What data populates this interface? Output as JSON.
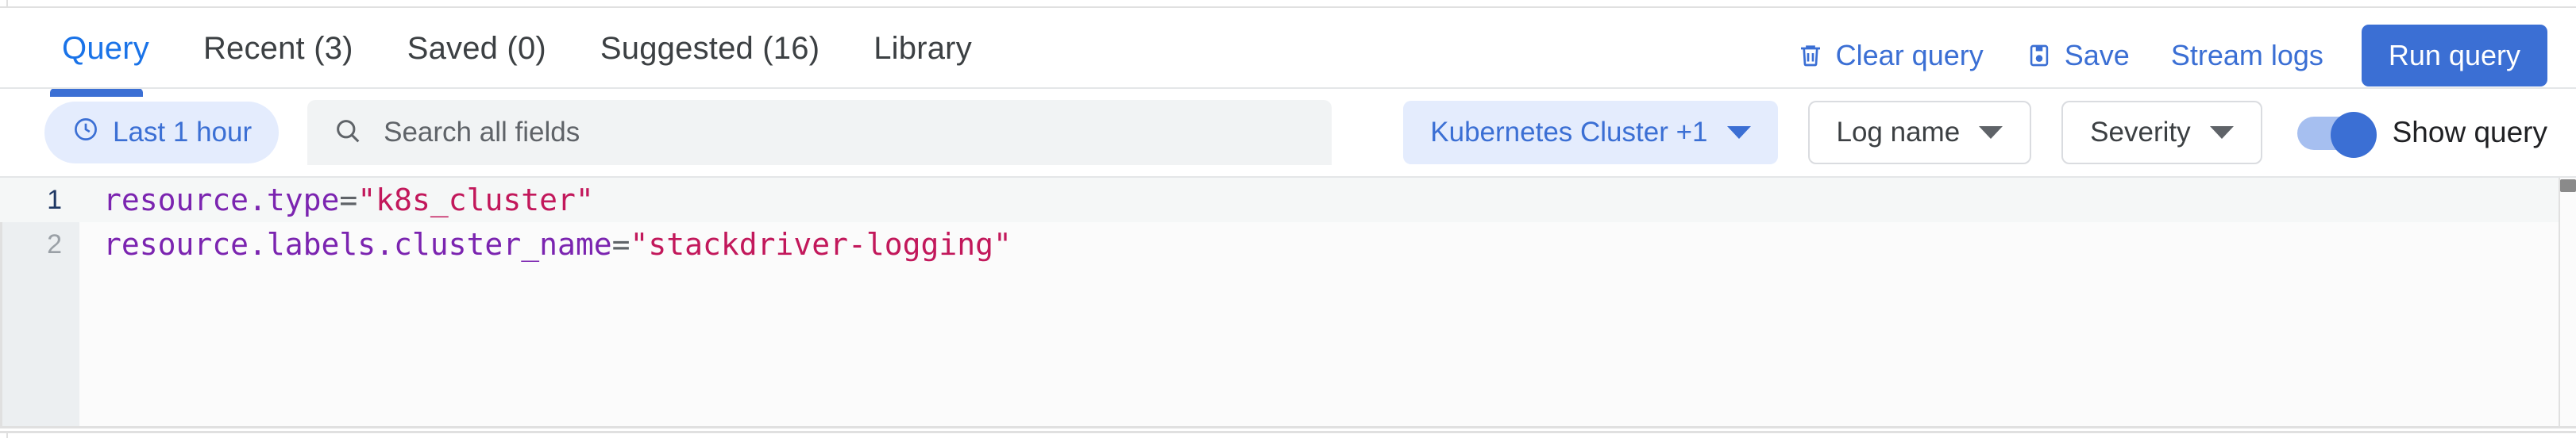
{
  "tabs": [
    {
      "label": "Query",
      "active": true
    },
    {
      "label": "Recent (3)",
      "active": false
    },
    {
      "label": "Saved (0)",
      "active": false
    },
    {
      "label": "Suggested (16)",
      "active": false
    },
    {
      "label": "Library",
      "active": false
    }
  ],
  "header_actions": {
    "clear_query": "Clear query",
    "clear_query_icon": "trash-icon",
    "save": "Save",
    "save_icon": "save-disk-icon",
    "stream_logs": "Stream logs",
    "run_query": "Run query"
  },
  "toolbar": {
    "time_range": "Last 1 hour",
    "time_range_icon": "clock-icon",
    "search_icon": "search-icon",
    "search_placeholder": "Search all fields",
    "search_value": "",
    "resource_filter": "Kubernetes Cluster +1",
    "log_name_filter": "Log name",
    "severity_filter": "Severity",
    "dropdown_icon": "chevron-down-icon",
    "show_query_label": "Show query",
    "show_query_on": true
  },
  "editor": {
    "lines": [
      {
        "number": "1",
        "active": true,
        "tokens": [
          {
            "type": "ident",
            "text": "resource.type"
          },
          {
            "type": "op",
            "text": "="
          },
          {
            "type": "str",
            "text": "\"k8s_cluster\""
          }
        ]
      },
      {
        "number": "2",
        "active": false,
        "tokens": [
          {
            "type": "ident",
            "text": "resource.labels.cluster_name"
          },
          {
            "type": "op",
            "text": "="
          },
          {
            "type": "str",
            "text": "\"stackdriver-logging\""
          }
        ]
      }
    ]
  },
  "colors": {
    "accent": "#3b6fd4",
    "tab_active": "#1a73e8",
    "chip_fill": "#e4ecfd",
    "search_bg": "#f1f3f4",
    "gutter_bg": "#eceff1",
    "editor_bg": "#fbfbfb",
    "identifier": "#7b24b0",
    "string": "#c2185b",
    "operator": "#5f6368"
  }
}
